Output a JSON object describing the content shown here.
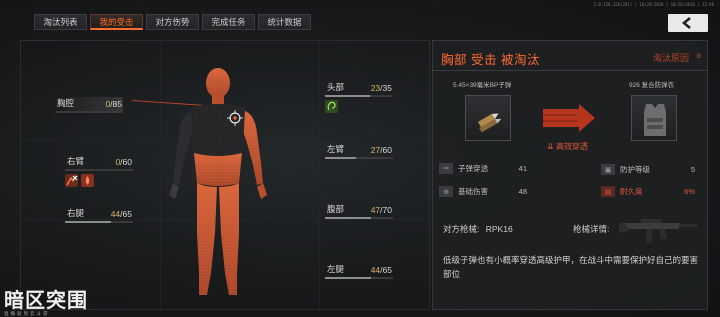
{
  "version": "1.0.126.128(201) | 10/26/2018 | 10/26/2018 | 23:46",
  "tabs": [
    {
      "label": "淘汰列表",
      "active": false
    },
    {
      "label": "我的受击",
      "active": true
    },
    {
      "label": "对方伤势",
      "active": false
    },
    {
      "label": "完成任务",
      "active": false
    },
    {
      "label": "统计数据",
      "active": false
    }
  ],
  "back_button": {
    "icon": "chevron-left-icon"
  },
  "body_parts": {
    "chest": {
      "label": "胸腔",
      "current": "0",
      "max": "/85",
      "fill": 0.0
    },
    "right_arm": {
      "label": "右臂",
      "current": "0",
      "max": "/60",
      "fill": 0.0
    },
    "right_leg": {
      "label": "右腿",
      "current": "44",
      "max": "/65",
      "fill": 0.68
    },
    "head": {
      "label": "头部",
      "current": "23",
      "max": "/35",
      "fill": 0.66
    },
    "left_arm": {
      "label": "左臂",
      "current": "27",
      "max": "/60",
      "fill": 0.45
    },
    "abdomen": {
      "label": "腹部",
      "current": "47",
      "max": "/70",
      "fill": 0.67
    },
    "left_leg": {
      "label": "左腿",
      "current": "44",
      "max": "/65",
      "fill": 0.68
    }
  },
  "info": {
    "title": "胸部  受击  被淘汰",
    "reason": "淘汰原因",
    "reason_mark": "ʙ",
    "ammo_name": "5.45×39毫米BP子弹",
    "armor_name": "926 复合防弹衣",
    "effect": "高效穿透",
    "ammo_stats": [
      {
        "label": "子弹穿透",
        "value": "41",
        "icon": "bullet-icon"
      },
      {
        "label": "基础伤害",
        "value": "48",
        "icon": "crosshair-icon"
      }
    ],
    "armor_stats": [
      {
        "label": "防护等级",
        "value": "5",
        "icon": "shield-icon"
      },
      {
        "label": "耐久度",
        "value": "6%",
        "icon": "durability-icon"
      }
    ],
    "weapon_label": "对方枪械:",
    "weapon_name": "RPK16",
    "weapon_detail": "枪械详情:",
    "description": "低级子弹也有小概率穿透高级护甲，在战斗中需要保护好自己的要害部位"
  },
  "logo": {
    "title": "暗区突围",
    "subtitle": "直播就到云斗游"
  },
  "colors": {
    "accent": "#ff6b2e",
    "damage": "#e05a3a",
    "value": "#d9b46a"
  }
}
